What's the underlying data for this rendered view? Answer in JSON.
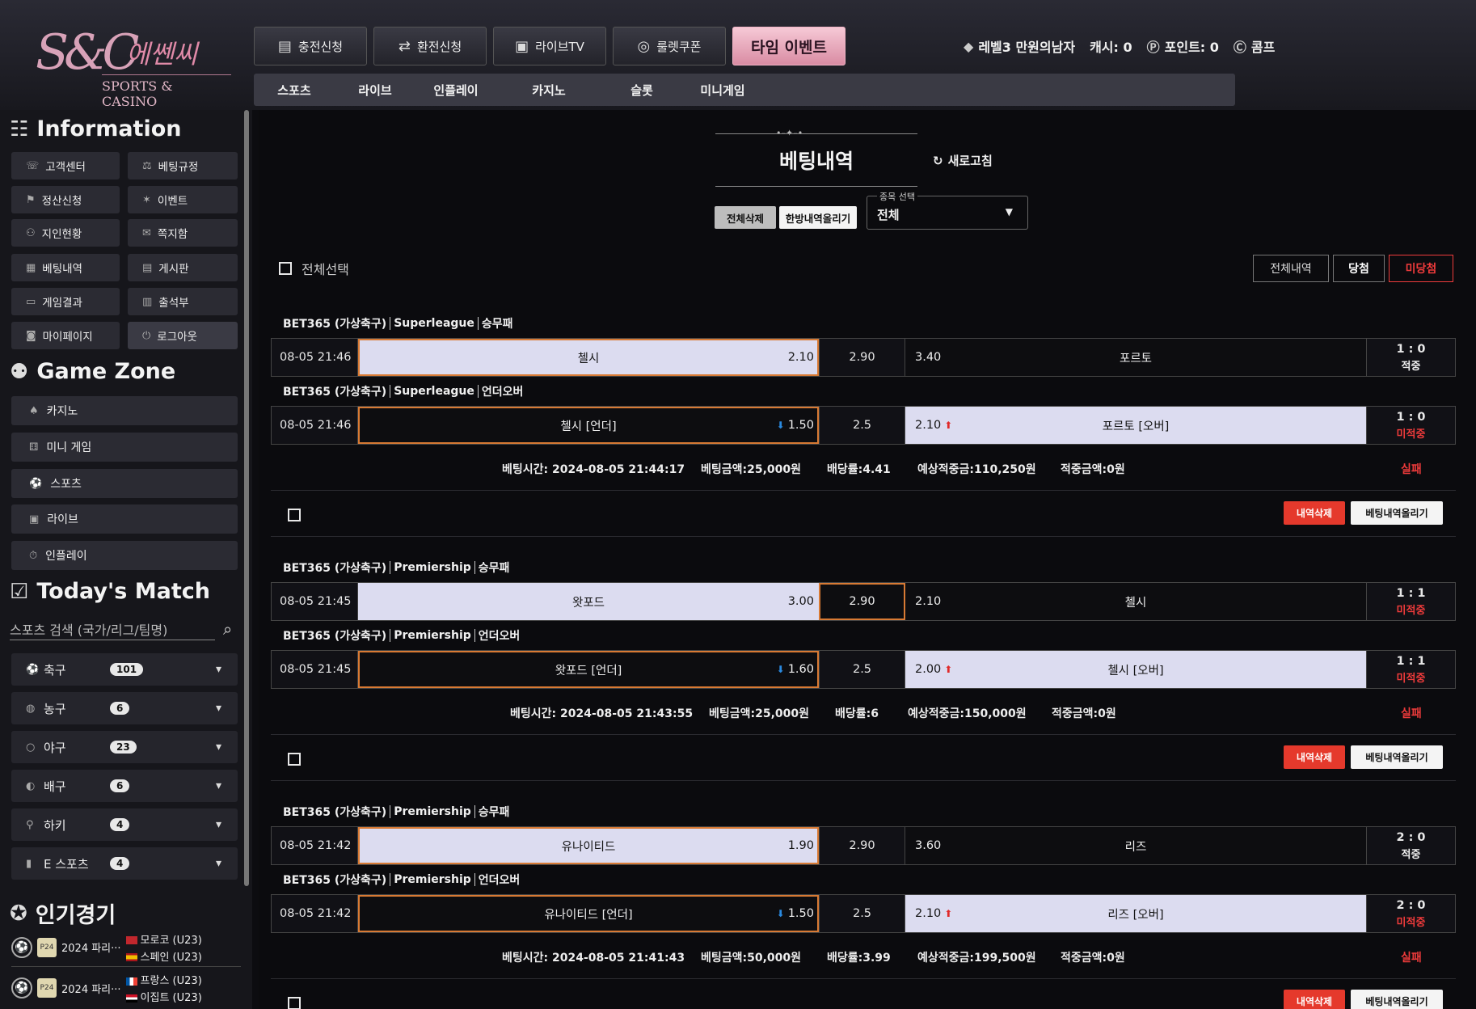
{
  "logo": {
    "mark": "S&C",
    "korean": "에쎈씨",
    "english": "SPORTS & CASINO"
  },
  "top_buttons": [
    {
      "label": "충전신청",
      "icon": "money-icon"
    },
    {
      "label": "환전신청",
      "icon": "exchange-icon"
    },
    {
      "label": "라이브TV",
      "icon": "tv-icon"
    },
    {
      "label": "룰렛쿠폰",
      "icon": "roulette-icon"
    },
    {
      "label": "타임 이벤트",
      "icon": ""
    }
  ],
  "user": {
    "level": "레벨3 만원의남자",
    "cash": "캐시: 0",
    "point": "포인트: 0",
    "comp": "콤프"
  },
  "game_nav": [
    "스포츠",
    "라이브",
    "인플레이",
    "카지노",
    "슬롯",
    "미니게임"
  ],
  "sidebar": {
    "info_title": "Information",
    "info_buttons": [
      "고객센터",
      "베팅규정",
      "정산신청",
      "이벤트",
      "지인현황",
      "쪽지함",
      "베팅내역",
      "게시판",
      "게임결과",
      "출석부",
      "마이페이지",
      "로그아웃"
    ],
    "gamezone_title": "Game Zone",
    "gamezone_items": [
      "카지노",
      "미니 게임",
      "스포츠",
      "라이브",
      "인플레이"
    ],
    "today_title": "Today's Match",
    "search_placeholder": "스포츠 검색 (국가/리그/팀명)",
    "sports": [
      {
        "name": "축구",
        "count": "101"
      },
      {
        "name": "농구",
        "count": "6"
      },
      {
        "name": "야구",
        "count": "23"
      },
      {
        "name": "배구",
        "count": "6"
      },
      {
        "name": "하키",
        "count": "4"
      },
      {
        "name": "E 스포츠",
        "count": "4"
      }
    ],
    "popular_title": "인기경기",
    "popular": [
      {
        "event": "2024 파리···",
        "team1": "모로코 (U23)",
        "team2": "스페인 (U23)"
      },
      {
        "event": "2024 파리···",
        "team1": "프랑스 (U23)",
        "team2": "이집트 (U23)"
      }
    ]
  },
  "main": {
    "title": "베팅내역",
    "refresh": "새로고침",
    "delete_all": "전체삭제",
    "upload_all": "한방내역올리기",
    "select_label": "종목 선택",
    "select_value": "전체",
    "check_all": "전체선택",
    "filters": [
      "전체내역",
      "당첨",
      "미당첨"
    ],
    "bets": [
      {
        "lines": [
          {
            "league": "BET365 (가상축구)",
            "sub": "Superleague",
            "market": "승무패",
            "date": "08-05 21:46",
            "home": "첼시",
            "home_odd": "2.10",
            "mid": "2.90",
            "away": "포르토",
            "away_odd": "3.40",
            "score": "1 : 0",
            "status": "적중"
          },
          {
            "league": "BET365 (가상축구)",
            "sub": "Superleague",
            "market": "언더오버",
            "date": "08-05 21:46",
            "home": "첼시 [언더]",
            "home_odd": "1.50",
            "mid": "2.5",
            "away": "포르토 [오버]",
            "away_odd": "2.10",
            "score": "1 : 0",
            "status": "미적중"
          }
        ],
        "bet_time": "베팅시간: 2024-08-05 21:44:17",
        "amount": "베팅금액:25,000원",
        "rate": "배당률:4.41",
        "expected": "예상적중금:110,250원",
        "won": "적중금액:0원",
        "result": "실패"
      },
      {
        "lines": [
          {
            "league": "BET365 (가상축구)",
            "sub": "Premiership",
            "market": "승무패",
            "date": "08-05 21:45",
            "home": "왓포드",
            "home_odd": "3.00",
            "mid": "2.90",
            "away": "첼시",
            "away_odd": "2.10",
            "score": "1 : 1",
            "status": "미적중"
          },
          {
            "league": "BET365 (가상축구)",
            "sub": "Premiership",
            "market": "언더오버",
            "date": "08-05 21:45",
            "home": "왓포드 [언더]",
            "home_odd": "1.60",
            "mid": "2.5",
            "away": "첼시 [오버]",
            "away_odd": "2.00",
            "score": "1 : 1",
            "status": "미적중"
          }
        ],
        "bet_time": "베팅시간: 2024-08-05 21:43:55",
        "amount": "베팅금액:25,000원",
        "rate": "배당률:6",
        "expected": "예상적중금:150,000원",
        "won": "적중금액:0원",
        "result": "실패"
      },
      {
        "lines": [
          {
            "league": "BET365 (가상축구)",
            "sub": "Premiership",
            "market": "승무패",
            "date": "08-05 21:42",
            "home": "유나이티드",
            "home_odd": "1.90",
            "mid": "2.90",
            "away": "리즈",
            "away_odd": "3.60",
            "score": "2 : 0",
            "status": "적중"
          },
          {
            "league": "BET365 (가상축구)",
            "sub": "Premiership",
            "market": "언더오버",
            "date": "08-05 21:42",
            "home": "유나이티드 [언더]",
            "home_odd": "1.50",
            "mid": "2.5",
            "away": "리즈 [오버]",
            "away_odd": "2.10",
            "score": "2 : 0",
            "status": "미적중"
          }
        ],
        "bet_time": "베팅시간: 2024-08-05 21:41:43",
        "amount": "베팅금액:50,000원",
        "rate": "배당률:3.99",
        "expected": "예상적중금:199,500원",
        "won": "적중금액:0원",
        "result": "실패"
      }
    ],
    "row_actions": {
      "delete": "내역삭제",
      "upload": "베팅내역올리기"
    }
  },
  "colors": {
    "accent_orange": "#d87a34",
    "fail_red": "#ef3b3b",
    "event_pink": "#f6c9d6"
  }
}
